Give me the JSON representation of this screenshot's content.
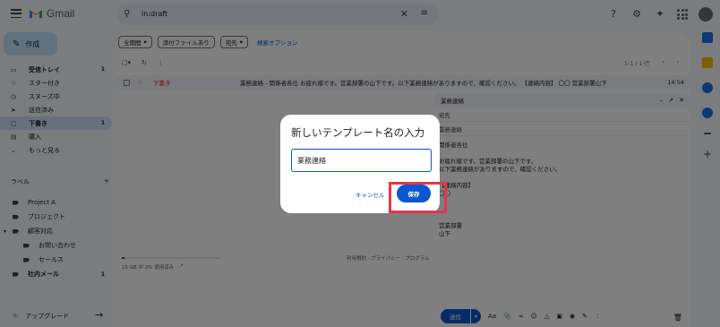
{
  "app": {
    "name": "Gmail"
  },
  "search": {
    "query": "in:draft"
  },
  "compose_label": "作成",
  "nav": [
    {
      "label": "受信トレイ",
      "count": "1",
      "icon": "inbox-icon",
      "bold": true
    },
    {
      "label": "スター付き",
      "count": "",
      "icon": "star-icon"
    },
    {
      "label": "スヌーズ中",
      "count": "",
      "icon": "clock-icon"
    },
    {
      "label": "送信済み",
      "count": "",
      "icon": "send-icon"
    },
    {
      "label": "下書き",
      "count": "1",
      "icon": "draft-icon",
      "active": true
    },
    {
      "label": "購入",
      "count": "",
      "icon": "bag-icon"
    },
    {
      "label": "もっと見る",
      "count": "",
      "icon": "chevron-down-icon"
    }
  ],
  "labels_title": "ラベル",
  "labels": [
    {
      "label": "Project A",
      "sub": false
    },
    {
      "label": "プロジェクト",
      "sub": false
    },
    {
      "label": "顧客対応",
      "sub": false,
      "caret": true
    },
    {
      "label": "お問い合わせ",
      "sub": true
    },
    {
      "label": "セールス",
      "sub": true
    },
    {
      "label": "社内メール",
      "sub": false,
      "count": "1",
      "bold": true
    }
  ],
  "upgrade_label": "アップグレード",
  "filters": {
    "chips": [
      "全期間",
      "添付ファイルあり",
      "宛先"
    ],
    "advanced": "検索オプション"
  },
  "pager": {
    "range": "1–1 / 1 行"
  },
  "row": {
    "status": "下書き",
    "subject": "業務連絡 - 関係者各位 お疲れ様です。営業部署の山下です。以下業務連絡がありますので、確認ください。 【連絡内容】 〇〇 営業部署山下",
    "time": "14:54"
  },
  "storage": {
    "text": "15 GB 中 3% 使用済み",
    "fill_percent": 3
  },
  "footer_links": "利用規約 · プライバシー · プログラム",
  "compose": {
    "title": "業務連絡",
    "to_label": "宛先",
    "subject": "業務連絡",
    "body": [
      "関係者各位",
      "",
      "お疲れ様です。営業部署の山下です。",
      "以下業務連絡がありますので、確認ください。",
      "",
      "【連絡内容】",
      "〇〇",
      "",
      "",
      "",
      "営業部署",
      "山下"
    ],
    "send_label": "送信"
  },
  "dialog": {
    "title": "新しいテンプレート名の入力",
    "input_value": "業務連絡",
    "cancel_label": "キャンセル",
    "save_label": "保存"
  },
  "colors": {
    "accent": "#0b57d0",
    "highlight": "#e8344a",
    "active_nav": "#d3e3fd"
  }
}
